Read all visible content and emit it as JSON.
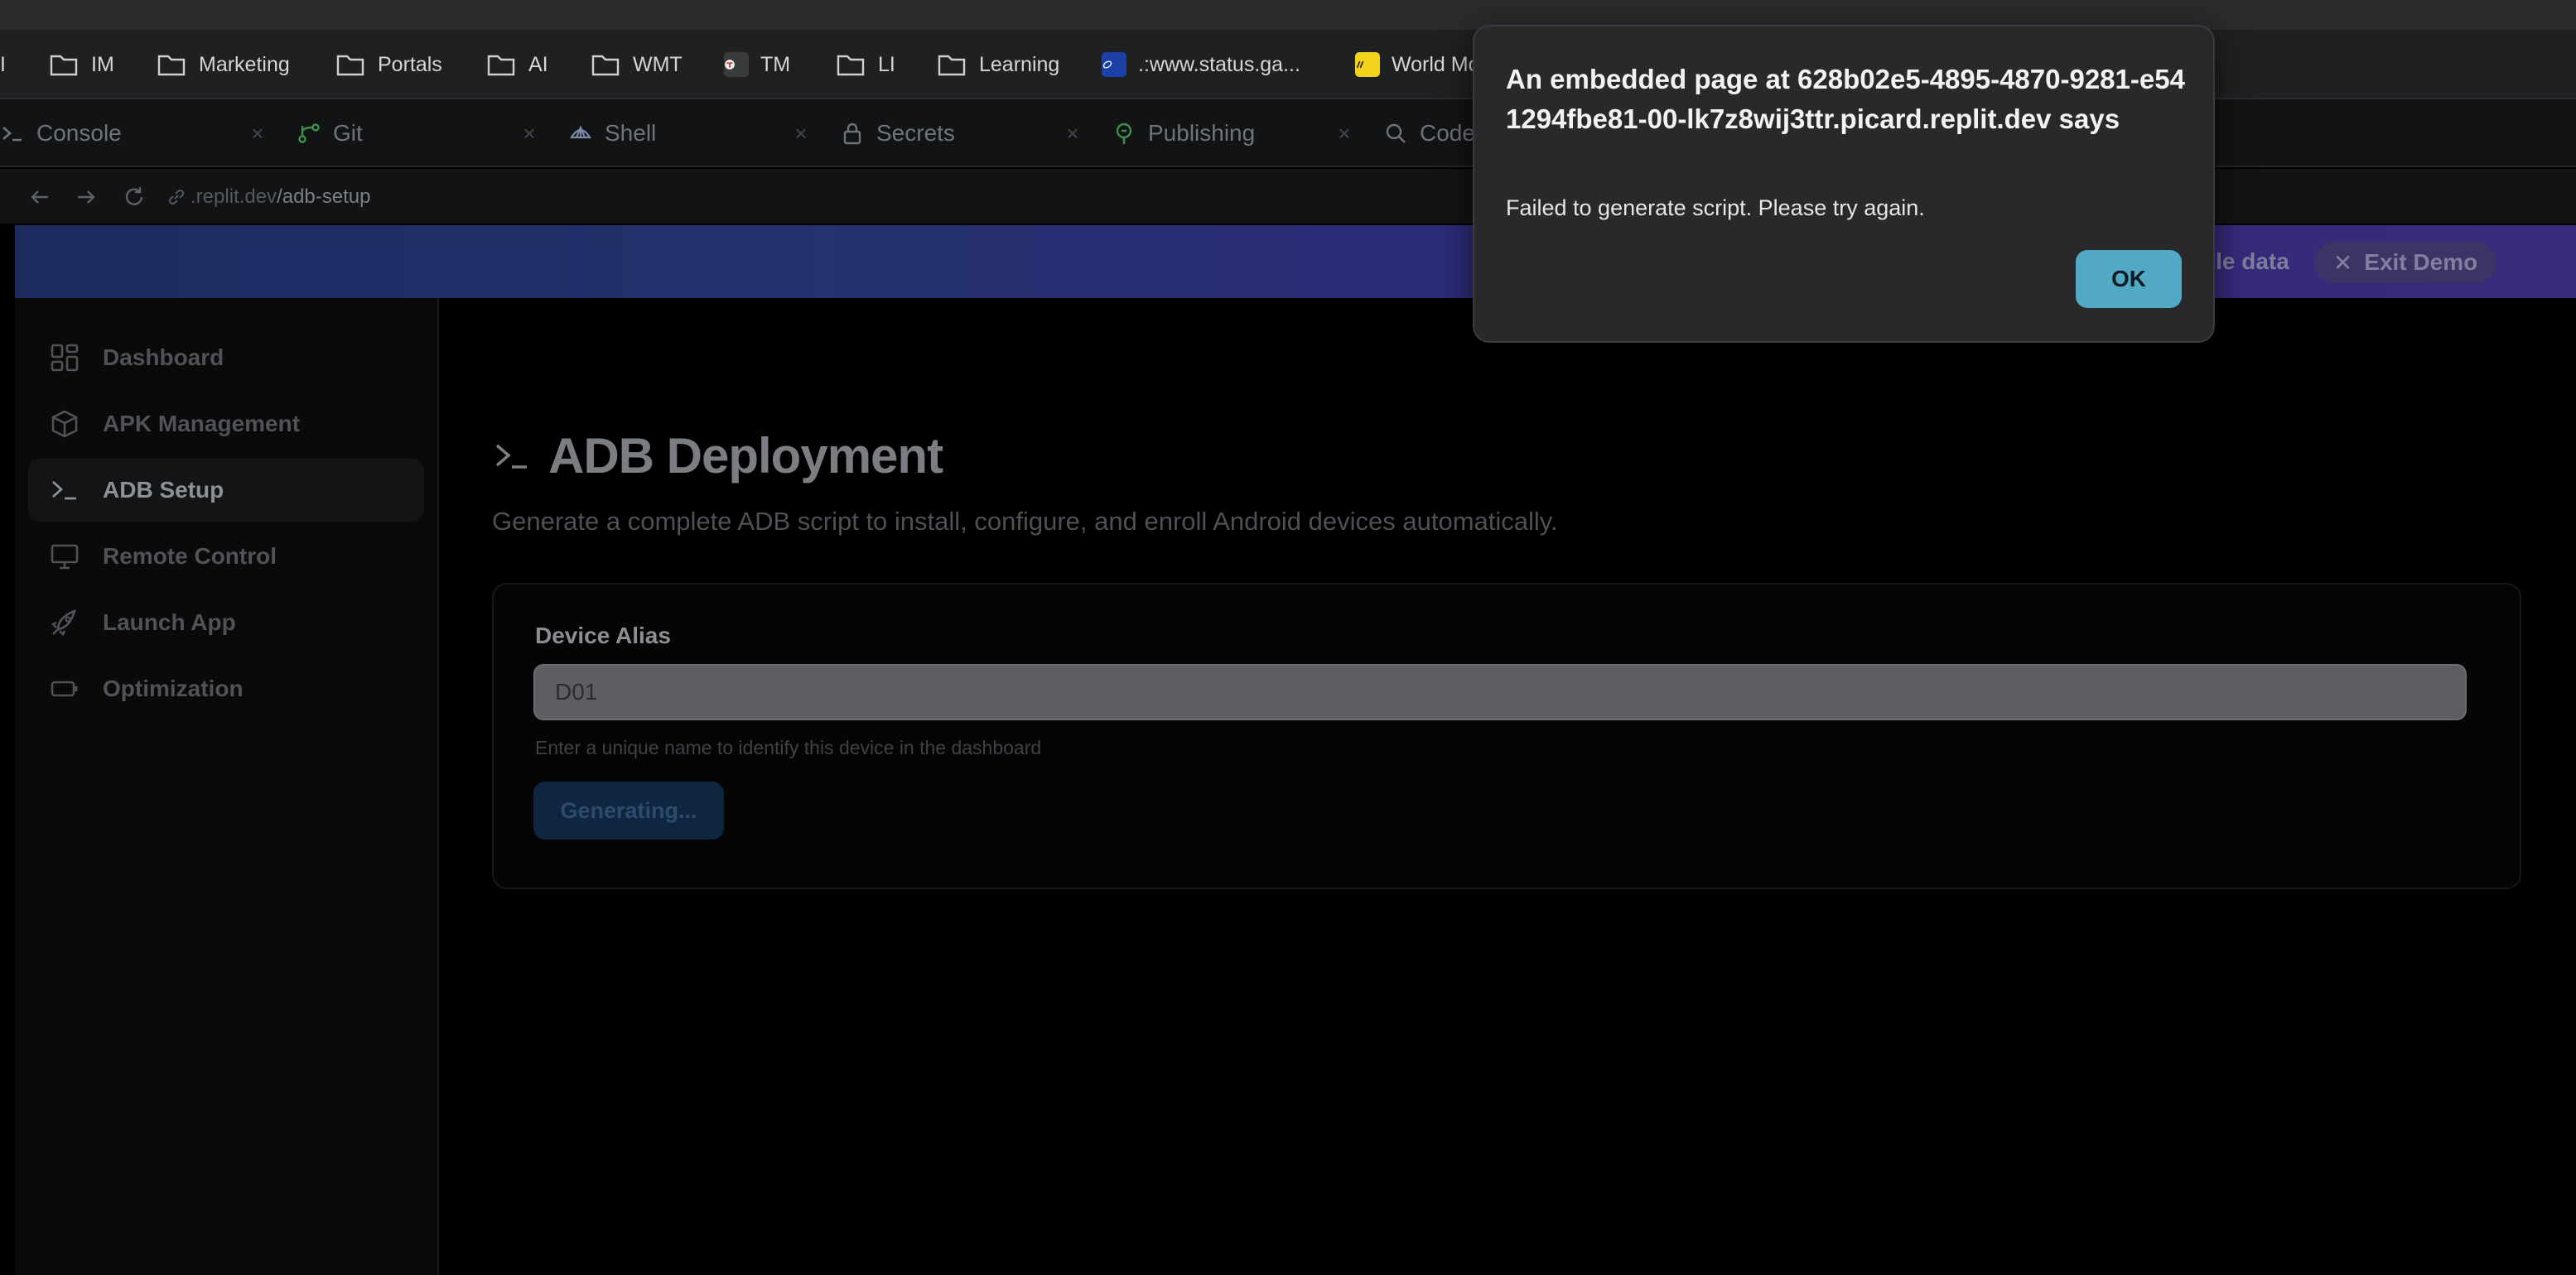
{
  "bookmarks": [
    {
      "label": "I",
      "icon": "bar-icon"
    },
    {
      "label": "IM",
      "icon": "folder-icon"
    },
    {
      "label": "Marketing",
      "icon": "folder-icon"
    },
    {
      "label": "Portals",
      "icon": "folder-icon"
    },
    {
      "label": "AI",
      "icon": "folder-icon"
    },
    {
      "label": "WMT",
      "icon": "folder-icon"
    },
    {
      "label": "TM",
      "icon": "tm-favicon"
    },
    {
      "label": "LI",
      "icon": "folder-icon"
    },
    {
      "label": "Learning",
      "icon": "folder-icon"
    },
    {
      "label": ".:www.status.ga...",
      "icon": "status-favicon"
    },
    {
      "label": "World Mo",
      "icon": "world-favicon"
    }
  ],
  "tabs": [
    {
      "label": "Console",
      "icon": "terminal-icon"
    },
    {
      "label": "Git",
      "icon": "git-icon"
    },
    {
      "label": "Shell",
      "icon": "shell-icon"
    },
    {
      "label": "Secrets",
      "icon": "lock-icon"
    },
    {
      "label": "Publishing",
      "icon": "publish-icon"
    },
    {
      "label": "Code",
      "icon": "search-icon"
    }
  ],
  "url": {
    "host": ".replit.dev",
    "path": "/adb-setup"
  },
  "banner": {
    "text": "ple data",
    "exit_label": "Exit Demo"
  },
  "sidebar": {
    "items": [
      {
        "label": "Dashboard",
        "icon": "grid-icon"
      },
      {
        "label": "APK Management",
        "icon": "package-icon"
      },
      {
        "label": "ADB Setup",
        "icon": "terminal-icon",
        "active": true
      },
      {
        "label": "Remote Control",
        "icon": "monitor-icon"
      },
      {
        "label": "Launch App",
        "icon": "rocket-icon"
      },
      {
        "label": "Optimization",
        "icon": "battery-icon"
      }
    ]
  },
  "main": {
    "title": "ADB Deployment",
    "subtitle": "Generate a complete ADB script to install, configure, and enroll Android devices automatically.",
    "form": {
      "label": "Device Alias",
      "value": "D01",
      "hint": "Enter a unique name to identify this device in the dashboard",
      "button_label": "Generating..."
    }
  },
  "dialog": {
    "title": "An embedded page at 628b02e5-4895-4870-9281-e541294fbe81-00-lk7z8wij3ttr.picard.replit.dev says",
    "message": "Failed to generate script. Please try again.",
    "ok_label": "OK"
  },
  "colors": {
    "accent": "#52a9c6",
    "banner_start": "#1c2b5e",
    "banner_end": "#3a2a7c",
    "background": "#000000"
  }
}
